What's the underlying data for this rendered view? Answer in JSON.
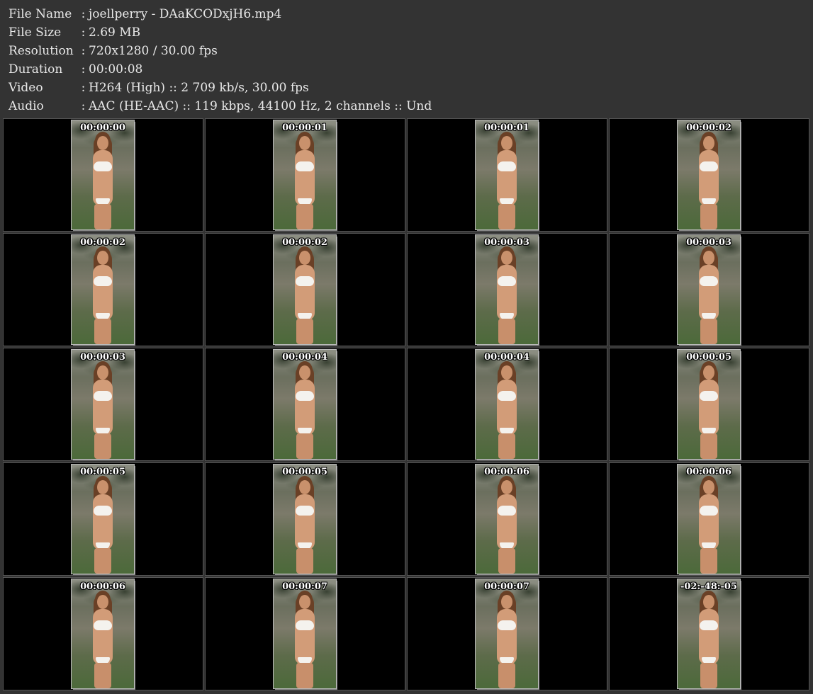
{
  "info": [
    {
      "key": "File Name",
      "sep": ":",
      "value": "joellperry - DAaKCODxjH6.mp4"
    },
    {
      "key": "File Size",
      "sep": ":",
      "value": "2.69 MB"
    },
    {
      "key": "Resolution",
      "sep": ":",
      "value": "720x1280 / 30.00 fps"
    },
    {
      "key": "Duration",
      "sep": ":",
      "value": "00:00:08"
    },
    {
      "key": "Video",
      "sep": ":",
      "value": "H264 (High) :: 2 709 kb/s, 30.00 fps"
    },
    {
      "key": "Audio",
      "sep": ":",
      "value": "AAC (HE-AAC) :: 119 kbps, 44100 Hz, 2 channels :: Und"
    }
  ],
  "thumbnails": [
    {
      "timestamp": "00:00:00"
    },
    {
      "timestamp": "00:00:01"
    },
    {
      "timestamp": "00:00:01"
    },
    {
      "timestamp": "00:00:02"
    },
    {
      "timestamp": "00:00:02"
    },
    {
      "timestamp": "00:00:02"
    },
    {
      "timestamp": "00:00:03"
    },
    {
      "timestamp": "00:00:03"
    },
    {
      "timestamp": "00:00:03"
    },
    {
      "timestamp": "00:00:04"
    },
    {
      "timestamp": "00:00:04"
    },
    {
      "timestamp": "00:00:05"
    },
    {
      "timestamp": "00:00:05"
    },
    {
      "timestamp": "00:00:05"
    },
    {
      "timestamp": "00:00:06"
    },
    {
      "timestamp": "00:00:06"
    },
    {
      "timestamp": "00:00:06"
    },
    {
      "timestamp": "00:00:07"
    },
    {
      "timestamp": "00:00:07"
    },
    {
      "timestamp": "-02:-48:-05"
    }
  ]
}
